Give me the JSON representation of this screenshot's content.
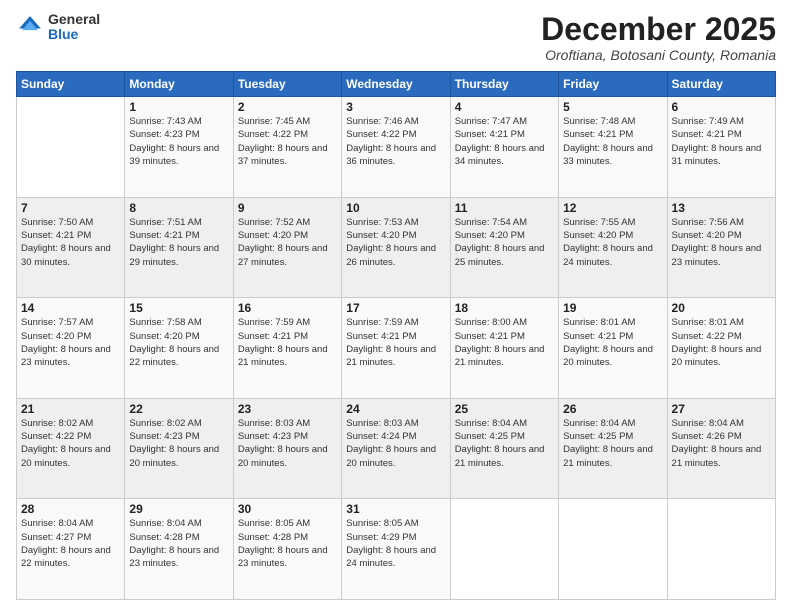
{
  "logo": {
    "general": "General",
    "blue": "Blue"
  },
  "header": {
    "month": "December 2025",
    "location": "Oroftiana, Botosani County, Romania"
  },
  "weekdays": [
    "Sunday",
    "Monday",
    "Tuesday",
    "Wednesday",
    "Thursday",
    "Friday",
    "Saturday"
  ],
  "weeks": [
    [
      {
        "day": "",
        "sunrise": "",
        "sunset": "",
        "daylight": ""
      },
      {
        "day": "1",
        "sunrise": "Sunrise: 7:43 AM",
        "sunset": "Sunset: 4:23 PM",
        "daylight": "Daylight: 8 hours and 39 minutes."
      },
      {
        "day": "2",
        "sunrise": "Sunrise: 7:45 AM",
        "sunset": "Sunset: 4:22 PM",
        "daylight": "Daylight: 8 hours and 37 minutes."
      },
      {
        "day": "3",
        "sunrise": "Sunrise: 7:46 AM",
        "sunset": "Sunset: 4:22 PM",
        "daylight": "Daylight: 8 hours and 36 minutes."
      },
      {
        "day": "4",
        "sunrise": "Sunrise: 7:47 AM",
        "sunset": "Sunset: 4:21 PM",
        "daylight": "Daylight: 8 hours and 34 minutes."
      },
      {
        "day": "5",
        "sunrise": "Sunrise: 7:48 AM",
        "sunset": "Sunset: 4:21 PM",
        "daylight": "Daylight: 8 hours and 33 minutes."
      },
      {
        "day": "6",
        "sunrise": "Sunrise: 7:49 AM",
        "sunset": "Sunset: 4:21 PM",
        "daylight": "Daylight: 8 hours and 31 minutes."
      }
    ],
    [
      {
        "day": "7",
        "sunrise": "Sunrise: 7:50 AM",
        "sunset": "Sunset: 4:21 PM",
        "daylight": "Daylight: 8 hours and 30 minutes."
      },
      {
        "day": "8",
        "sunrise": "Sunrise: 7:51 AM",
        "sunset": "Sunset: 4:21 PM",
        "daylight": "Daylight: 8 hours and 29 minutes."
      },
      {
        "day": "9",
        "sunrise": "Sunrise: 7:52 AM",
        "sunset": "Sunset: 4:20 PM",
        "daylight": "Daylight: 8 hours and 27 minutes."
      },
      {
        "day": "10",
        "sunrise": "Sunrise: 7:53 AM",
        "sunset": "Sunset: 4:20 PM",
        "daylight": "Daylight: 8 hours and 26 minutes."
      },
      {
        "day": "11",
        "sunrise": "Sunrise: 7:54 AM",
        "sunset": "Sunset: 4:20 PM",
        "daylight": "Daylight: 8 hours and 25 minutes."
      },
      {
        "day": "12",
        "sunrise": "Sunrise: 7:55 AM",
        "sunset": "Sunset: 4:20 PM",
        "daylight": "Daylight: 8 hours and 24 minutes."
      },
      {
        "day": "13",
        "sunrise": "Sunrise: 7:56 AM",
        "sunset": "Sunset: 4:20 PM",
        "daylight": "Daylight: 8 hours and 23 minutes."
      }
    ],
    [
      {
        "day": "14",
        "sunrise": "Sunrise: 7:57 AM",
        "sunset": "Sunset: 4:20 PM",
        "daylight": "Daylight: 8 hours and 23 minutes."
      },
      {
        "day": "15",
        "sunrise": "Sunrise: 7:58 AM",
        "sunset": "Sunset: 4:20 PM",
        "daylight": "Daylight: 8 hours and 22 minutes."
      },
      {
        "day": "16",
        "sunrise": "Sunrise: 7:59 AM",
        "sunset": "Sunset: 4:21 PM",
        "daylight": "Daylight: 8 hours and 21 minutes."
      },
      {
        "day": "17",
        "sunrise": "Sunrise: 7:59 AM",
        "sunset": "Sunset: 4:21 PM",
        "daylight": "Daylight: 8 hours and 21 minutes."
      },
      {
        "day": "18",
        "sunrise": "Sunrise: 8:00 AM",
        "sunset": "Sunset: 4:21 PM",
        "daylight": "Daylight: 8 hours and 21 minutes."
      },
      {
        "day": "19",
        "sunrise": "Sunrise: 8:01 AM",
        "sunset": "Sunset: 4:21 PM",
        "daylight": "Daylight: 8 hours and 20 minutes."
      },
      {
        "day": "20",
        "sunrise": "Sunrise: 8:01 AM",
        "sunset": "Sunset: 4:22 PM",
        "daylight": "Daylight: 8 hours and 20 minutes."
      }
    ],
    [
      {
        "day": "21",
        "sunrise": "Sunrise: 8:02 AM",
        "sunset": "Sunset: 4:22 PM",
        "daylight": "Daylight: 8 hours and 20 minutes."
      },
      {
        "day": "22",
        "sunrise": "Sunrise: 8:02 AM",
        "sunset": "Sunset: 4:23 PM",
        "daylight": "Daylight: 8 hours and 20 minutes."
      },
      {
        "day": "23",
        "sunrise": "Sunrise: 8:03 AM",
        "sunset": "Sunset: 4:23 PM",
        "daylight": "Daylight: 8 hours and 20 minutes."
      },
      {
        "day": "24",
        "sunrise": "Sunrise: 8:03 AM",
        "sunset": "Sunset: 4:24 PM",
        "daylight": "Daylight: 8 hours and 20 minutes."
      },
      {
        "day": "25",
        "sunrise": "Sunrise: 8:04 AM",
        "sunset": "Sunset: 4:25 PM",
        "daylight": "Daylight: 8 hours and 21 minutes."
      },
      {
        "day": "26",
        "sunrise": "Sunrise: 8:04 AM",
        "sunset": "Sunset: 4:25 PM",
        "daylight": "Daylight: 8 hours and 21 minutes."
      },
      {
        "day": "27",
        "sunrise": "Sunrise: 8:04 AM",
        "sunset": "Sunset: 4:26 PM",
        "daylight": "Daylight: 8 hours and 21 minutes."
      }
    ],
    [
      {
        "day": "28",
        "sunrise": "Sunrise: 8:04 AM",
        "sunset": "Sunset: 4:27 PM",
        "daylight": "Daylight: 8 hours and 22 minutes."
      },
      {
        "day": "29",
        "sunrise": "Sunrise: 8:04 AM",
        "sunset": "Sunset: 4:28 PM",
        "daylight": "Daylight: 8 hours and 23 minutes."
      },
      {
        "day": "30",
        "sunrise": "Sunrise: 8:05 AM",
        "sunset": "Sunset: 4:28 PM",
        "daylight": "Daylight: 8 hours and 23 minutes."
      },
      {
        "day": "31",
        "sunrise": "Sunrise: 8:05 AM",
        "sunset": "Sunset: 4:29 PM",
        "daylight": "Daylight: 8 hours and 24 minutes."
      },
      {
        "day": "",
        "sunrise": "",
        "sunset": "",
        "daylight": ""
      },
      {
        "day": "",
        "sunrise": "",
        "sunset": "",
        "daylight": ""
      },
      {
        "day": "",
        "sunrise": "",
        "sunset": "",
        "daylight": ""
      }
    ]
  ]
}
